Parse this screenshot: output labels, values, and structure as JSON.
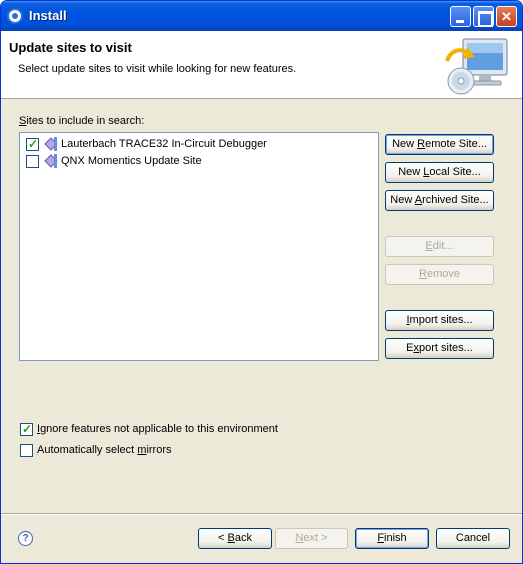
{
  "window": {
    "title": "Install",
    "controls": {
      "minimize": "minimize",
      "maximize": "maximize",
      "close": "close"
    }
  },
  "banner": {
    "title": "Update sites to visit",
    "description": "Select update sites to visit while looking for new features."
  },
  "sites": {
    "label_prefix": "",
    "label_mnemonic": "S",
    "label_rest": "ites to include in search:",
    "items": [
      {
        "label": "Lauterbach TRACE32 In-Circuit Debugger",
        "checked": true
      },
      {
        "label": "QNX Momentics Update Site",
        "checked": false
      }
    ]
  },
  "side_buttons": {
    "new_remote": {
      "pre": "New ",
      "mn": "R",
      "post": "emote Site..."
    },
    "new_local": {
      "pre": "New ",
      "mn": "L",
      "post": "ocal Site..."
    },
    "new_archived": {
      "pre": "New ",
      "mn": "A",
      "post": "rchived Site..."
    },
    "edit": {
      "pre": "",
      "mn": "E",
      "post": "dit..."
    },
    "remove": {
      "pre": "",
      "mn": "R",
      "post": "emove"
    },
    "import": {
      "pre": "",
      "mn": "I",
      "post": "mport sites..."
    },
    "export": {
      "pre": "E",
      "mn": "x",
      "post": "port sites..."
    }
  },
  "options": {
    "ignore": {
      "pre": "",
      "mn": "I",
      "post": "gnore features not applicable to this environment",
      "checked": true
    },
    "mirrors": {
      "pre": "Automatically select ",
      "mn": "m",
      "post": "irrors",
      "checked": false
    }
  },
  "footer": {
    "help": "?",
    "back": {
      "pre": "< ",
      "mn": "B",
      "post": "ack"
    },
    "next": {
      "pre": "",
      "mn": "N",
      "post": "ext >"
    },
    "finish": {
      "pre": "",
      "mn": "F",
      "post": "inish"
    },
    "cancel": "Cancel"
  },
  "colors": {
    "title_bar": "#0054e3",
    "dialog_bg": "#ece9d8",
    "check_green": "#21a121",
    "button_border": "#003c74"
  }
}
